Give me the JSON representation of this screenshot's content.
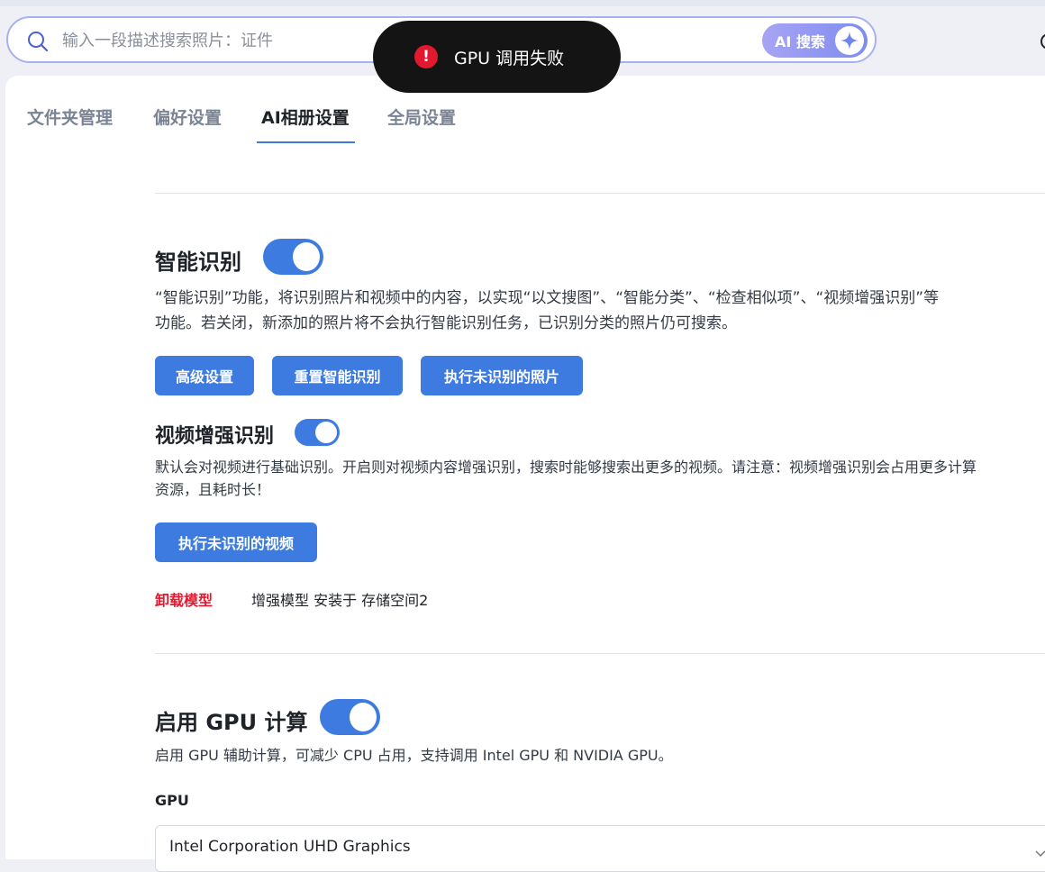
{
  "search": {
    "placeholder": "输入一段描述搜索照片：证件",
    "ai_button_label": "AI 搜索"
  },
  "toast": {
    "message": "GPU 调用失败",
    "icon": "error-icon"
  },
  "tabs": [
    {
      "label": "文件夹管理",
      "active": false
    },
    {
      "label": "偏好设置",
      "active": false
    },
    {
      "label": "AI相册设置",
      "active": true
    },
    {
      "label": "全局设置",
      "active": false
    }
  ],
  "smart_recognition": {
    "title": "智能识别",
    "enabled": true,
    "description_line1": "“智能识别”功能，将识别照片和视频中的内容，以实现“以文搜图”、“智能分类”、“检查相似项”、“视频增强识别”等",
    "description_line2": "功能。若关闭，新添加的照片将不会执行智能识别任务，已识别分类的照片仍可搜索。",
    "buttons": [
      "高级设置",
      "重置智能识别",
      "执行未识别的照片"
    ]
  },
  "video_enhance": {
    "title": "视频增强识别",
    "enabled": true,
    "description_line1": "默认会对视频进行基础识别。开启则对视频内容增强识别，搜索时能够搜索出更多的视频。请注意：视频增强识别会占用更多计算",
    "description_line2": "资源，且耗时长！",
    "button": "执行未识别的视频",
    "uninstall_label": "卸载模型",
    "model_info": "增强模型 安装于 存储空间2"
  },
  "gpu": {
    "title": "启用 GPU 计算",
    "enabled": true,
    "description": "启用 GPU 辅助计算，可减少 CPU 占用，支持调用 Intel GPU 和 NVIDIA GPU。",
    "field_label": "GPU",
    "selected": "Intel Corporation UHD Graphics"
  },
  "colors": {
    "accent": "#3d7be0",
    "danger": "#e0192f",
    "toast_bg": "#141414"
  }
}
